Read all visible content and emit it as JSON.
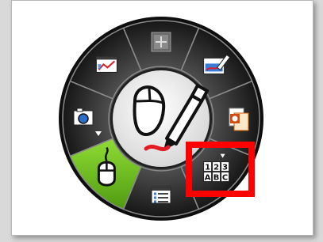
{
  "menu": {
    "segments": [
      {
        "name": "capture-area-button",
        "icon": "crosshair-icon",
        "selected": false
      },
      {
        "name": "whiteboard-button",
        "icon": "whiteboard-pen-icon",
        "selected": false
      },
      {
        "name": "office-documents-button",
        "icon": "office-documents-icon",
        "selected": false
      },
      {
        "name": "keyboard-button",
        "icon": "keyboard-icon",
        "selected": false
      },
      {
        "name": "list-window-button",
        "icon": "list-window-icon",
        "selected": false,
        "highlighted": true
      },
      {
        "name": "mouse-mode-button",
        "icon": "mouse-icon",
        "selected": true
      },
      {
        "name": "camera-button",
        "icon": "camera-icon",
        "selected": false
      },
      {
        "name": "chart-window-button",
        "icon": "chart-window-icon",
        "selected": false
      }
    ],
    "center": {
      "name": "mouse-and-pen-center-button",
      "icon": "mouse-pen-icon"
    },
    "colors": {
      "ring": "#3a3a3a",
      "ring_dark": "#1e1e1e",
      "selected": "#6cc21b",
      "highlight": "#ff0000",
      "divider": "#8a8a8a",
      "center": "#f4f4f4",
      "ink": "#e21b23"
    }
  }
}
